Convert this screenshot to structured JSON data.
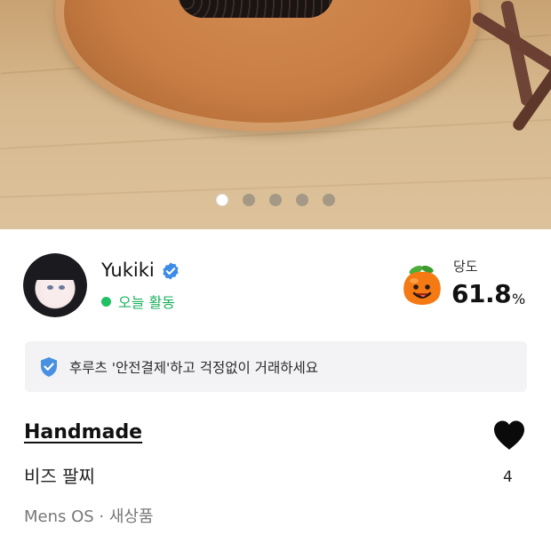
{
  "carousel": {
    "total_images": 5,
    "active_index": 0
  },
  "seller": {
    "name": "Yukiki",
    "verified": true,
    "activity_status": "오늘 활동",
    "status_color": "#20c063"
  },
  "temperature": {
    "label": "당도",
    "value": "61.8",
    "unit": "%",
    "icon": "peach-icon"
  },
  "notice": {
    "text": "후루츠 '안전결제'하고 걱정없이 거래하세요",
    "icon": "shield-check-icon",
    "accent": "#4a90e2"
  },
  "product": {
    "brand": "Handmade",
    "title": "비즈 팔찌",
    "meta": "Mens OS · 새상품",
    "likes": "4"
  }
}
